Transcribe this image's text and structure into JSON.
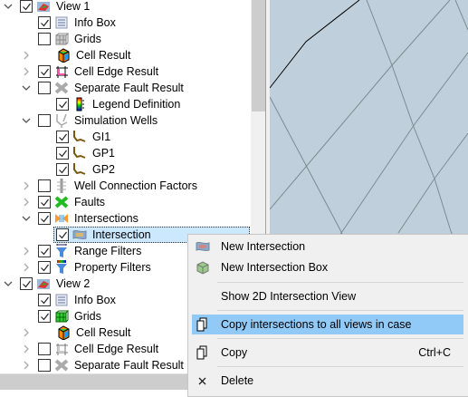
{
  "tree": [
    {
      "label": "View 1",
      "level": 0,
      "exp": "open",
      "check": true,
      "icon": "view-icon"
    },
    {
      "label": "Info Box",
      "level": 1,
      "exp": "",
      "check": true,
      "icon": "info-box-icon"
    },
    {
      "label": "Grids",
      "level": 1,
      "exp": "",
      "check": false,
      "icon": "grids-icon"
    },
    {
      "label": "Cell Result",
      "level": 1,
      "exp": "closed",
      "check": null,
      "icon": "cell-result-icon"
    },
    {
      "label": "Cell Edge Result",
      "level": 1,
      "exp": "closed",
      "check": true,
      "icon": "cell-edge-icon"
    },
    {
      "label": "Separate Fault Result",
      "level": 1,
      "exp": "open",
      "check": false,
      "icon": "fault-result-icon"
    },
    {
      "label": "Legend Definition",
      "level": 2,
      "exp": "",
      "check": true,
      "icon": "legend-icon"
    },
    {
      "label": "Simulation Wells",
      "level": 1,
      "exp": "open",
      "check": false,
      "icon": "wells-icon"
    },
    {
      "label": "GI1",
      "level": 2,
      "exp": "",
      "check": true,
      "icon": "well-icon"
    },
    {
      "label": "GP1",
      "level": 2,
      "exp": "",
      "check": true,
      "icon": "well-icon"
    },
    {
      "label": "GP2",
      "level": 2,
      "exp": "",
      "check": true,
      "icon": "well-icon"
    },
    {
      "label": "Well Connection Factors",
      "level": 1,
      "exp": "closed",
      "check": false,
      "icon": "well-connection-icon"
    },
    {
      "label": "Faults",
      "level": 1,
      "exp": "closed",
      "check": true,
      "icon": "faults-icon"
    },
    {
      "label": "Intersections",
      "level": 1,
      "exp": "open",
      "check": true,
      "icon": "intersections-icon"
    },
    {
      "label": "Intersection",
      "level": 2,
      "exp": "",
      "check": true,
      "icon": "intersection-icon",
      "selected": true
    },
    {
      "label": "Range Filters",
      "level": 1,
      "exp": "closed",
      "check": true,
      "icon": "range-filter-icon"
    },
    {
      "label": "Property Filters",
      "level": 1,
      "exp": "closed",
      "check": true,
      "icon": "property-filter-icon"
    },
    {
      "label": "View 2",
      "level": 0,
      "exp": "open",
      "check": true,
      "icon": "view-icon"
    },
    {
      "label": "Info Box",
      "level": 1,
      "exp": "",
      "check": true,
      "icon": "info-box-icon"
    },
    {
      "label": "Grids",
      "level": 1,
      "exp": "",
      "check": true,
      "icon": "grids-green-icon"
    },
    {
      "label": "Cell Result",
      "level": 1,
      "exp": "closed",
      "check": null,
      "icon": "cell-result-icon"
    },
    {
      "label": "Cell Edge Result",
      "level": 1,
      "exp": "closed",
      "check": false,
      "icon": "cell-edge-gray-icon"
    },
    {
      "label": "Separate Fault Result",
      "level": 1,
      "exp": "closed",
      "check": false,
      "icon": "fault-result-icon"
    }
  ],
  "menu": [
    {
      "label": "New Intersection",
      "icon": "new-intersection-icon",
      "shortcut": ""
    },
    {
      "label": "New Intersection Box",
      "icon": "new-intersection-box-icon",
      "shortcut": ""
    },
    {
      "sep": true
    },
    {
      "label": "Show 2D Intersection View",
      "icon": "",
      "shortcut": ""
    },
    {
      "sep": true
    },
    {
      "label": "Copy intersections to all views in case",
      "icon": "copy-icon",
      "shortcut": "",
      "highlighted": true
    },
    {
      "sep": true
    },
    {
      "label": "Copy",
      "icon": "copy-icon",
      "shortcut": "Ctrl+C"
    },
    {
      "sep": true
    },
    {
      "label": "Delete",
      "icon": "delete-icon",
      "shortcut": ""
    }
  ],
  "colors": {
    "viewport": "#bfd0dc",
    "highlight": "#91c9f7",
    "selection": "#cce8ff"
  }
}
